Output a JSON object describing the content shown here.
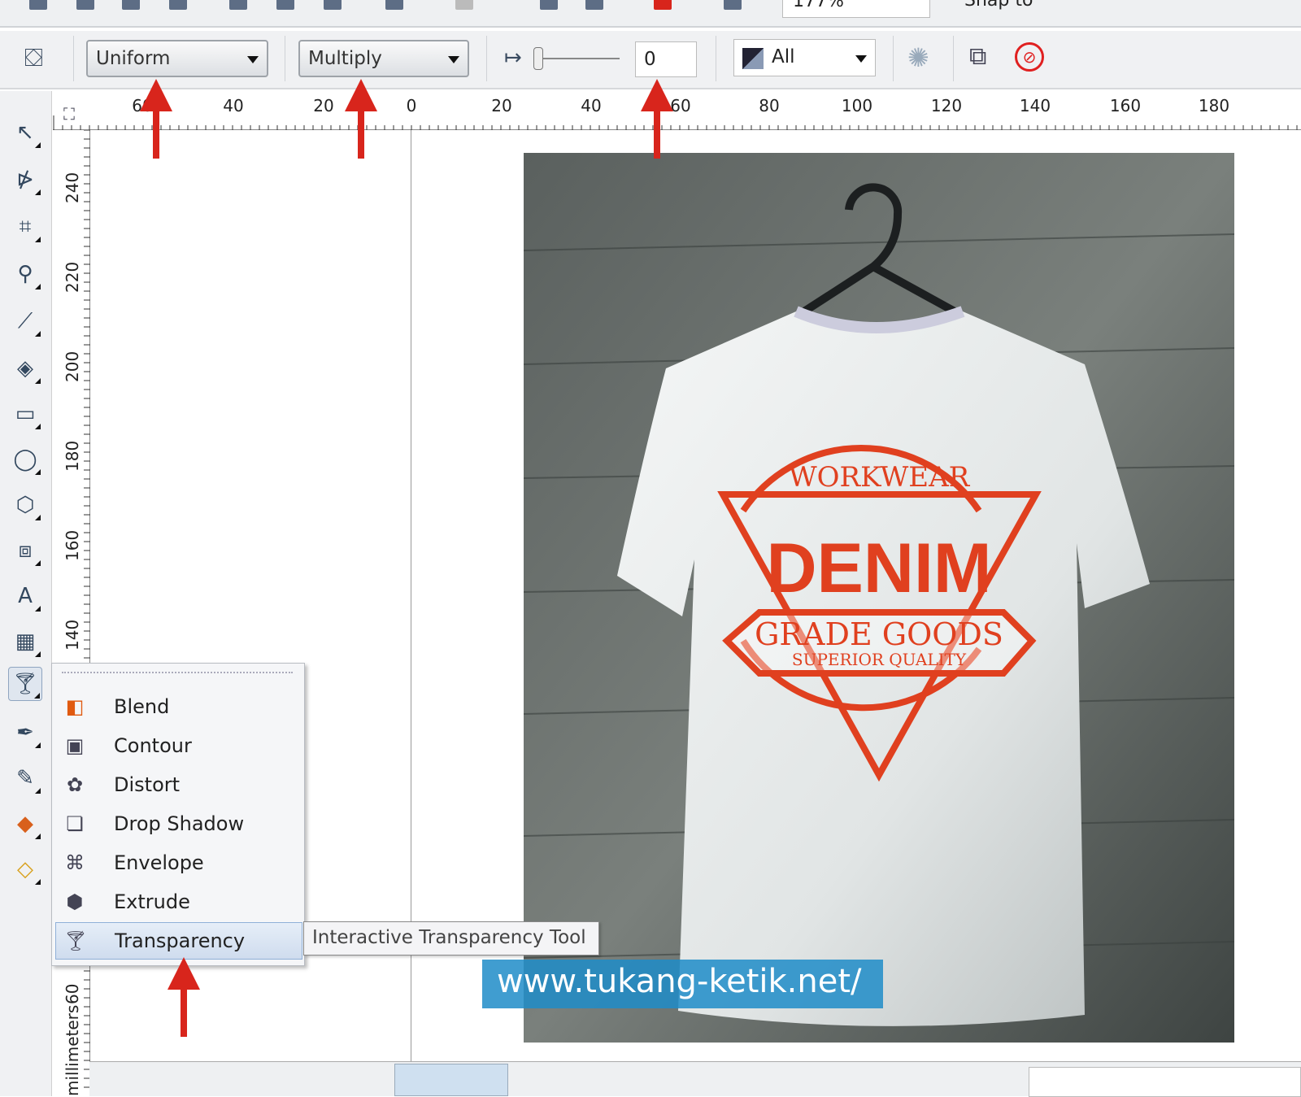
{
  "top_toolbar": {
    "zoom_value": "177%",
    "snap_label": "Snap to"
  },
  "property_bar": {
    "transparency_type": "Uniform",
    "merge_mode": "Multiply",
    "transparency_value": "0",
    "transparency_value_fraction": 0,
    "target": "All"
  },
  "ruler": {
    "horizontal": [
      "60",
      "40",
      "20",
      "0",
      "20",
      "40",
      "60",
      "80",
      "100",
      "120",
      "140",
      "160",
      "180"
    ],
    "vertical": [
      "240",
      "220",
      "200",
      "180",
      "160",
      "140",
      "60"
    ],
    "unit": "millimeters"
  },
  "flyout": {
    "items": [
      {
        "label": "Blend",
        "icon": "blend-icon"
      },
      {
        "label": "Contour",
        "icon": "contour-icon"
      },
      {
        "label": "Distort",
        "icon": "distort-icon"
      },
      {
        "label": "Drop Shadow",
        "icon": "drop-shadow-icon"
      },
      {
        "label": "Envelope",
        "icon": "envelope-icon"
      },
      {
        "label": "Extrude",
        "icon": "extrude-icon"
      },
      {
        "label": "Transparency",
        "icon": "transparency-icon",
        "selected": true
      }
    ]
  },
  "tooltip": "Interactive Transparency Tool",
  "watermark": "www.tukang-ketik.net/",
  "artwork": {
    "line1": "WORKWEAR",
    "line2": "DENIM",
    "line3": "GRADE GOODS",
    "line4": "SUPERIOR QUALITY"
  },
  "colors": {
    "arrow": "#d8251c",
    "design": "#e0401f",
    "watermark": "#1e8cc8"
  }
}
